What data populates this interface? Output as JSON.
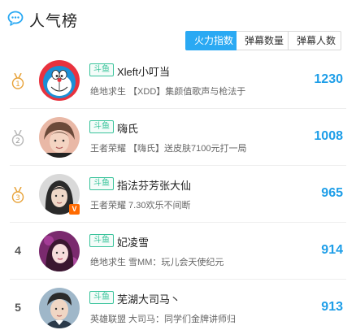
{
  "header": {
    "title": "人气榜",
    "icon": "chat-bubble-icon"
  },
  "tabs": [
    {
      "label": "火力指数",
      "active": true
    },
    {
      "label": "弹幕数量",
      "active": false
    },
    {
      "label": "弹幕人数",
      "active": false
    }
  ],
  "colors": {
    "accent": "#2aa9f3",
    "score": "#1e9ee8",
    "platform_tag": "#39c39b",
    "medal": "#e8a33a",
    "medal_silver": "#b8b8b8",
    "v_badge": "#ff6a00"
  },
  "rows": [
    {
      "rank": "1",
      "medal": "gold",
      "platform": "斗鱼",
      "name": "Xleft小叮当",
      "desc": "绝地求生 【XDD】集颜值歌声与枪法于",
      "score": "1230",
      "avatar": "doraemon-avatar"
    },
    {
      "rank": "2",
      "medal": "silver",
      "platform": "斗鱼",
      "name": "嗨氏",
      "desc": "王者荣耀 【嗨氏】送皮肤7100元打一局",
      "score": "1008",
      "avatar": "streamer-avatar"
    },
    {
      "rank": "3",
      "medal": "bronze",
      "platform": "斗鱼",
      "name": "指法芬芳张大仙",
      "desc": "王者荣耀 7.30欢乐不间断",
      "score": "965",
      "avatar": "streamer-avatar",
      "verified": "V"
    },
    {
      "rank": "4",
      "medal": "",
      "platform": "斗鱼",
      "name": "妃凌雪",
      "desc": "绝地求生 雪MM：玩儿会天使纪元",
      "score": "914",
      "avatar": "streamer-avatar"
    },
    {
      "rank": "5",
      "medal": "",
      "platform": "斗鱼",
      "name": "芜湖大司马丶",
      "desc": "英雄联盟 大司马：同学们金牌讲师归",
      "score": "913",
      "avatar": "streamer-avatar"
    }
  ]
}
